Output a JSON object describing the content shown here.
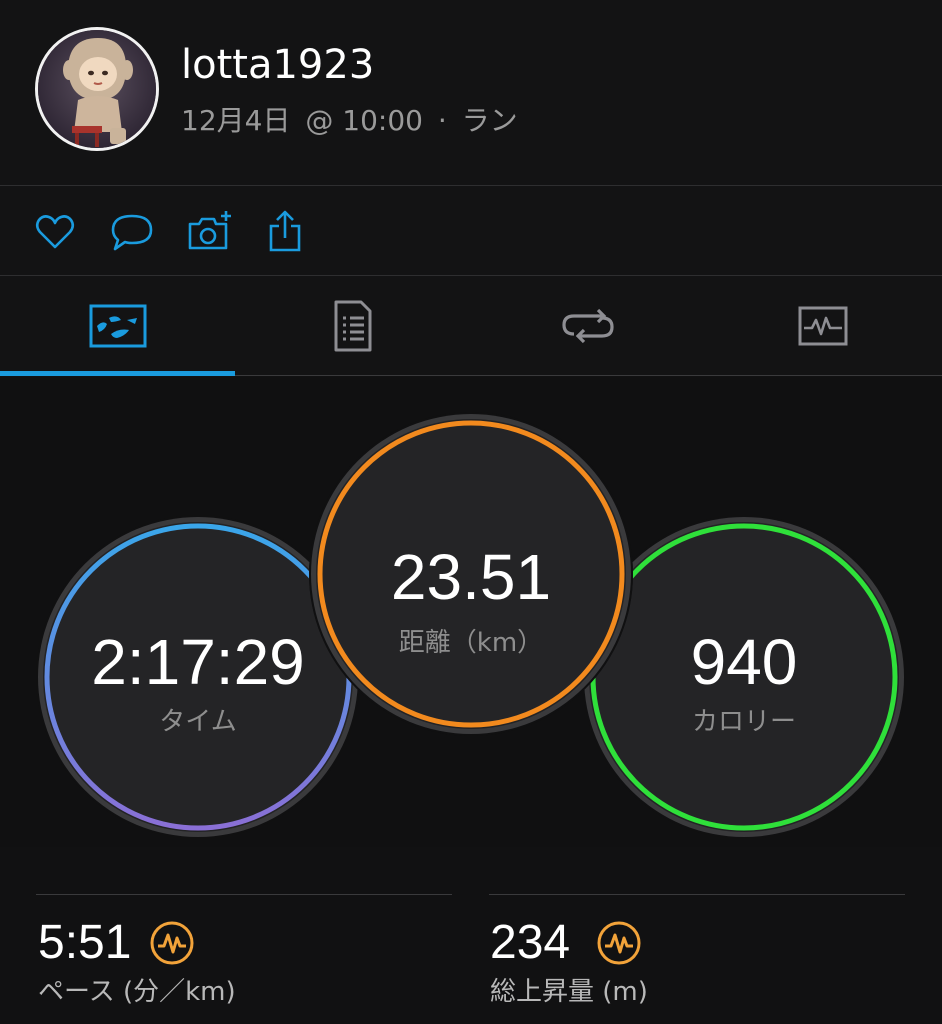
{
  "profile": {
    "username": "lotta1923",
    "date": "12月4日",
    "time": "@ 10:00",
    "separator": "·",
    "activity": "ラン"
  },
  "actions": [
    {
      "icon": "heart-icon"
    },
    {
      "icon": "comment-icon"
    },
    {
      "icon": "add-photo-icon"
    },
    {
      "icon": "share-icon"
    }
  ],
  "tabs": [
    {
      "icon": "map-overview-icon",
      "active": true
    },
    {
      "icon": "stats-document-icon",
      "active": false
    },
    {
      "icon": "laps-loop-icon",
      "active": false
    },
    {
      "icon": "chart-icon",
      "active": false
    }
  ],
  "rings": {
    "time": {
      "value": "2:17:29",
      "label": "タイム"
    },
    "distance": {
      "value": "23.51",
      "label": "距離（km）"
    },
    "calories": {
      "value": "940",
      "label": "カロリー"
    }
  },
  "stats": {
    "pace": {
      "value": "5:51",
      "label": "ペース (分／km)",
      "icon": "activity-badge-icon"
    },
    "ascent": {
      "value": "234",
      "label": "総上昇量 (m)",
      "icon": "activity-badge-icon"
    }
  },
  "colors": {
    "accent": "#1a9bde",
    "time_ring_top": "#3aa6ea",
    "time_ring_bottom": "#8a6fd6",
    "distance_ring": "#f28a1e",
    "calories_ring": "#2fe03a",
    "badge": "#f2a33a"
  }
}
